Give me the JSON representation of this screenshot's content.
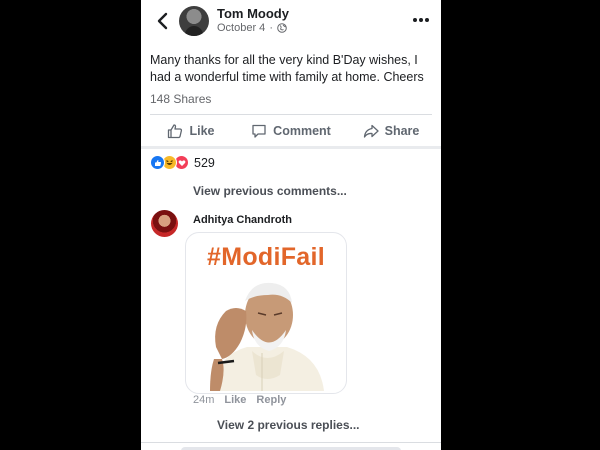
{
  "post": {
    "author": "Tom Moody",
    "date": "October 4",
    "meta_separator": "·",
    "text": "Many thanks for all the very kind B'Day wishes, I had a wonderful time with family at home. Cheers",
    "shares": "148 Shares"
  },
  "actions": {
    "like": "Like",
    "comment": "Comment",
    "share": "Share"
  },
  "reactions": {
    "count": "529",
    "types": [
      "like-icon",
      "haha-icon",
      "love-icon"
    ]
  },
  "comments": {
    "view_previous": "View previous comments...",
    "commenter": "Adhitya Chandroth",
    "image_text": "#ModiFail",
    "time": "24m",
    "like_label": "Like",
    "reply_label": "Reply",
    "view_replies": "View 2 previous replies..."
  },
  "colors": {
    "hashtag": "#e2662a",
    "like_blue": "#1877f2",
    "love_red": "#f33e58",
    "haha_yellow": "#f7b928"
  }
}
